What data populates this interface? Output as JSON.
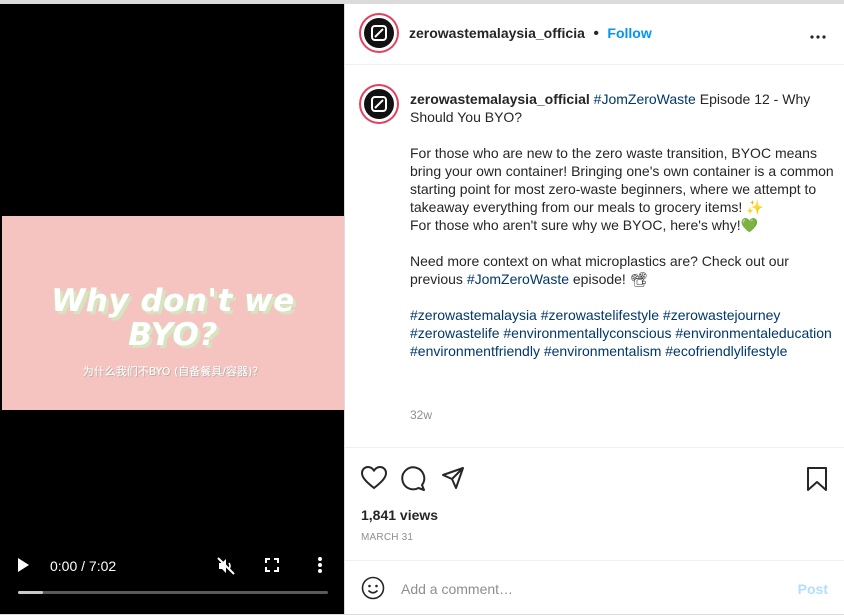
{
  "video": {
    "slide_title_line1": "Why don't we",
    "slide_title_line2": "BYO?",
    "slide_subtitle": "为什么我们不BYO (自备餐具/容器)？",
    "time_display": "0:00 / 7:02",
    "progress_fraction": 0.08
  },
  "header": {
    "username": "zerowastemalaysia_officia",
    "separator": "•",
    "follow_label": "Follow",
    "more_icon": "more-horizontal-icon"
  },
  "caption": {
    "username": "zerowastemalaysia_official",
    "hashtag_title": "#JomZeroWaste",
    "title_rest": " Episode 12 - Why Should You BYO?",
    "para1": "For those who are new to the zero waste transition, BYOC means bring your own container! Bringing one's own container is a common starting point for most zero-waste beginners, where we attempt to takeaway everything from our meals to grocery items! ✨",
    "para1b": "For those who aren't sure why we BYOC, here's why!💚",
    "para2_text": "Need more context on what microplastics are? Check out our previous ",
    "para2_tag": "#JomZeroWaste",
    "para2_end": " episode! 📽",
    "hashtags": [
      "#zerowastemalaysia",
      "#zerowastelifestyle",
      "#zerowastejourney",
      "#zerowastelife",
      "#environmentallyconscious",
      "#environmentaleducation",
      "#environmentfriendly",
      "#environmentalism",
      "#ecofriendlylifestyle"
    ],
    "age": "32w"
  },
  "stats": {
    "views": "1,841 views",
    "date": "MARCH 31"
  },
  "comment": {
    "placeholder": "Add a comment…",
    "post_label": "Post"
  },
  "colors": {
    "accent": "#0095f6",
    "hashtag": "#00376b",
    "slide_bg": "#f5c4c0"
  }
}
